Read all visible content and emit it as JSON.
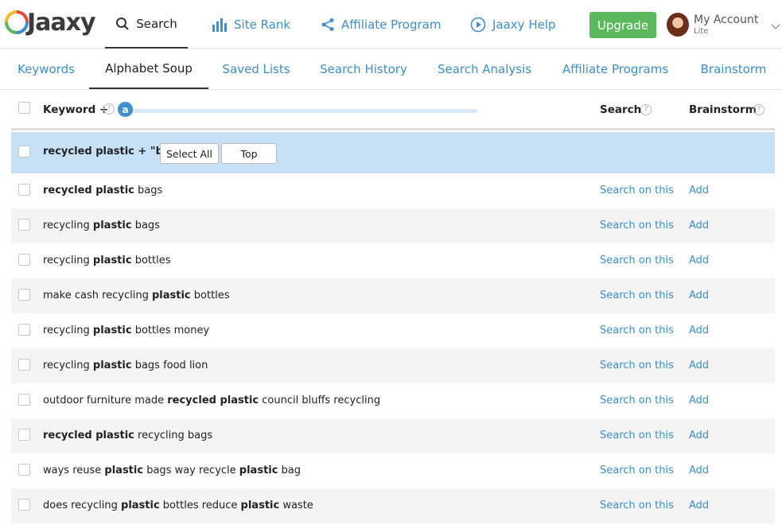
{
  "brand": {
    "name": "Jaaxy"
  },
  "nav": {
    "items": [
      {
        "label": "Search",
        "icon": "search-icon",
        "active": true
      },
      {
        "label": "Site Rank",
        "icon": "bar-chart-icon"
      },
      {
        "label": "Affiliate Program",
        "icon": "share-icon"
      },
      {
        "label": "Jaaxy Help",
        "icon": "play-circle-icon"
      }
    ],
    "upgrade_label": "Upgrade",
    "account": {
      "name": "My Account",
      "plan": "Lite"
    }
  },
  "tabs": [
    {
      "label": "Keywords"
    },
    {
      "label": "Alphabet Soup",
      "active": true
    },
    {
      "label": "Saved Lists"
    },
    {
      "label": "Search History"
    },
    {
      "label": "Search Analysis"
    },
    {
      "label": "Affiliate Programs"
    },
    {
      "label": "Brainstorm"
    }
  ],
  "table": {
    "headers": {
      "keyword": "Keyword +",
      "search": "Search",
      "brainstorm": "Brainstorm",
      "help": "?"
    },
    "slider": {
      "letter": "a"
    },
    "group": {
      "label": "recycled plastic + \"b\"",
      "select_all": "Select All",
      "top": "Top"
    },
    "search_link": "Search on this",
    "add_link": "Add",
    "rows": [
      {
        "parts": [
          {
            "t": "recycled plastic",
            "b": true
          },
          {
            "t": " bags",
            "b": false
          }
        ]
      },
      {
        "parts": [
          {
            "t": "recycling ",
            "b": false
          },
          {
            "t": "plastic",
            "b": true
          },
          {
            "t": " bags",
            "b": false
          }
        ]
      },
      {
        "parts": [
          {
            "t": "recycling ",
            "b": false
          },
          {
            "t": "plastic",
            "b": true
          },
          {
            "t": " bottles",
            "b": false
          }
        ]
      },
      {
        "parts": [
          {
            "t": "make cash recycling ",
            "b": false
          },
          {
            "t": "plastic",
            "b": true
          },
          {
            "t": " bottles",
            "b": false
          }
        ]
      },
      {
        "parts": [
          {
            "t": "recycling ",
            "b": false
          },
          {
            "t": "plastic",
            "b": true
          },
          {
            "t": " bottles money",
            "b": false
          }
        ]
      },
      {
        "parts": [
          {
            "t": "recycling ",
            "b": false
          },
          {
            "t": "plastic",
            "b": true
          },
          {
            "t": " bags food lion",
            "b": false
          }
        ]
      },
      {
        "parts": [
          {
            "t": "outdoor furniture made ",
            "b": false
          },
          {
            "t": "recycled plastic",
            "b": true
          },
          {
            "t": " council bluffs recycling",
            "b": false
          }
        ]
      },
      {
        "parts": [
          {
            "t": "recycled plastic",
            "b": true
          },
          {
            "t": " recycling bags",
            "b": false
          }
        ]
      },
      {
        "parts": [
          {
            "t": "ways reuse ",
            "b": false
          },
          {
            "t": "plastic",
            "b": true
          },
          {
            "t": " bags way recycle ",
            "b": false
          },
          {
            "t": "plastic",
            "b": true
          },
          {
            "t": " bag",
            "b": false
          }
        ]
      },
      {
        "parts": [
          {
            "t": "does recycling ",
            "b": false
          },
          {
            "t": "plastic",
            "b": true
          },
          {
            "t": " bottles reduce ",
            "b": false
          },
          {
            "t": "plastic",
            "b": true
          },
          {
            "t": " waste",
            "b": false
          }
        ]
      }
    ]
  },
  "colors": {
    "accent": "#3d8fcf",
    "upgrade": "#5cb85c",
    "highlight_row": "#c6e0f5",
    "alt_row": "#f4f4f4"
  }
}
